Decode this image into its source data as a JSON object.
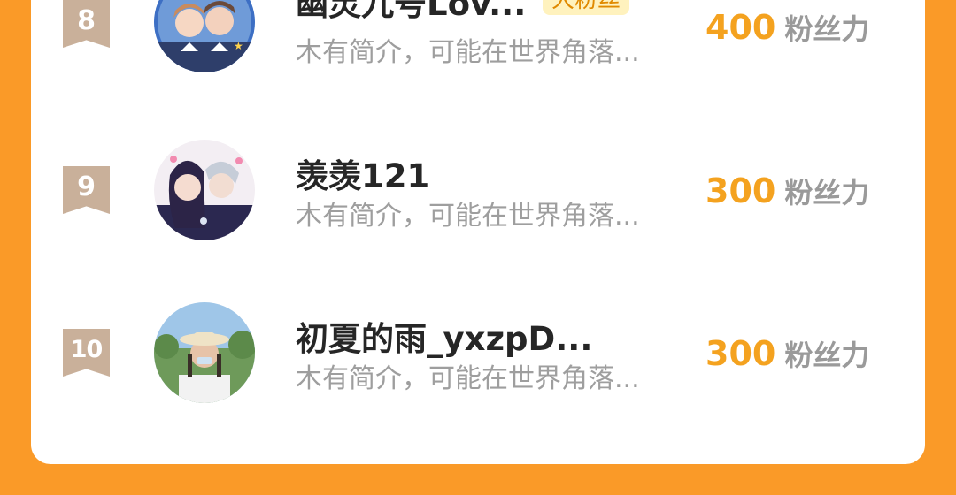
{
  "fans": [
    {
      "rank": "8",
      "name": "幽灵九号Lov...",
      "tag": "大粉丝",
      "bio": "木有简介，可能在世界角落...",
      "score": "400",
      "score_unit": "粉丝力",
      "avatar": "anime-boys-avatar"
    },
    {
      "rank": "9",
      "name": "羡羡121",
      "tag": "",
      "bio": "木有简介，可能在世界角落...",
      "score": "300",
      "score_unit": "粉丝力",
      "avatar": "anime-couple-avatar"
    },
    {
      "rank": "10",
      "name": "初夏的雨_yxzpD...",
      "tag": "",
      "bio": "木有简介，可能在世界角落...",
      "score": "300",
      "score_unit": "粉丝力",
      "avatar": "photo-girl-avatar"
    }
  ],
  "colors": {
    "page_background": "#FA9A28",
    "score": "#F4A21F",
    "rank_badge": "#C9B09A",
    "tag_background": "#FFF2BE"
  }
}
